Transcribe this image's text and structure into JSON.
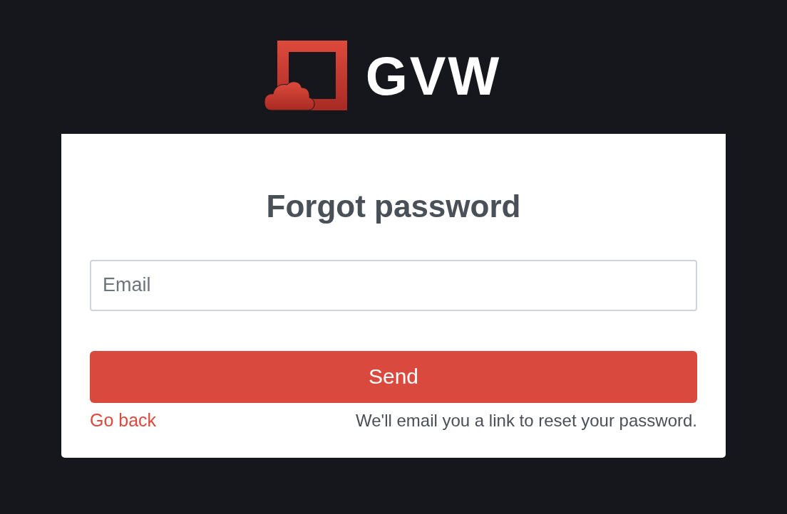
{
  "logo": {
    "wordmark": "GVW"
  },
  "card": {
    "title": "Forgot password",
    "email_field": {
      "placeholder": "Email"
    },
    "send_button": "Send",
    "back_link": "Go back",
    "hint": "We'll email you a link to reset your password."
  }
}
